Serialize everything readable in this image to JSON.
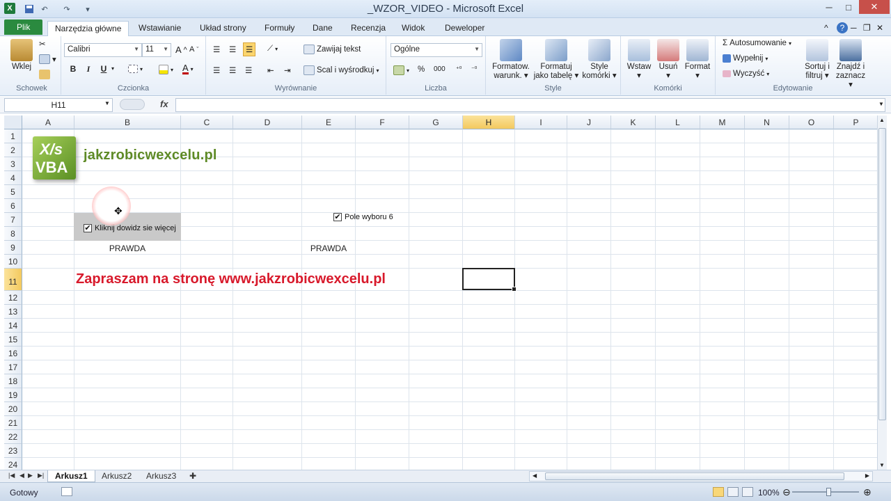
{
  "window": {
    "title": "_WZOR_VIDEO  -  Microsoft Excel",
    "app_icon": "excel-icon",
    "controls": [
      "minimize",
      "maximize",
      "close"
    ]
  },
  "ribbon_tabs": [
    "Plik",
    "Narzędzia główne",
    "Wstawianie",
    "Układ strony",
    "Formuły",
    "Dane",
    "Recenzja",
    "Widok",
    "Deweloper"
  ],
  "ribbon_active_tab": "Narzędzia główne",
  "ribbon": {
    "clipboard": {
      "label": "Schowek",
      "paste": "Wklej"
    },
    "font": {
      "label": "Czcionka",
      "font_name": "Calibri",
      "font_size": "11",
      "bold": "B",
      "italic": "I",
      "underline": "U",
      "font_color_letter": "A"
    },
    "alignment": {
      "label": "Wyrównanie",
      "wrap": "Zawijaj tekst",
      "merge": "Scal i wyśrodkuj"
    },
    "number": {
      "label": "Liczba",
      "format": "Ogólne",
      "percent": "%",
      "thousands": "000"
    },
    "styles": {
      "label": "Style",
      "conditional_1": "Formatow.",
      "conditional_2": "warunk.",
      "table_1": "Formatuj",
      "table_2": "jako tabelę",
      "cell_1": "Style",
      "cell_2": "komórki"
    },
    "cells": {
      "label": "Komórki",
      "insert": "Wstaw",
      "delete": "Usuń",
      "format": "Format"
    },
    "editing": {
      "label": "Edytowanie",
      "autosum": "Autosumowanie",
      "fill": "Wypełnij",
      "clear": "Wyczyść",
      "sort_1": "Sortuj i",
      "sort_2": "filtruj",
      "find_1": "Znajdź i",
      "find_2": "zaznacz"
    }
  },
  "formula_bar": {
    "name_box": "H11",
    "fx": "fx",
    "content": ""
  },
  "columns": [
    "A",
    "B",
    "C",
    "D",
    "E",
    "F",
    "G",
    "H",
    "I",
    "J",
    "K",
    "L",
    "M",
    "N",
    "O",
    "P"
  ],
  "selected_column": "H",
  "rows": [
    "1",
    "2",
    "3",
    "4",
    "5",
    "6",
    "7",
    "8",
    "9",
    "10",
    "11",
    "12",
    "13",
    "14",
    "15",
    "16",
    "17",
    "18",
    "19",
    "20",
    "21",
    "22",
    "23",
    "24"
  ],
  "selected_cell": "H11",
  "sheet_content": {
    "logo_line1": "X/s",
    "logo_line2": "VBA",
    "logo_text": "jakzrobicwexcelu.pl",
    "checkbox1_label": "Kliknij dowidz sie więcej",
    "checkbox1_checked": "✔",
    "checkbox2_label": "Pole wyboru 6",
    "checkbox2_checked": "✔",
    "b9": "PRAWDA",
    "e9": "PRAWDA",
    "promo": "Zapraszam na stronę www.jakzrobicwexcelu.pl"
  },
  "sheets": [
    "Arkusz1",
    "Arkusz2",
    "Arkusz3"
  ],
  "active_sheet": "Arkusz1",
  "status": {
    "ready": "Gotowy",
    "zoom": "100%"
  },
  "colors": {
    "file_tab": "#2a8a3f",
    "promo_text": "#d8192b",
    "logo_text": "#5e8a26",
    "selected_header": "#f3c95e"
  }
}
